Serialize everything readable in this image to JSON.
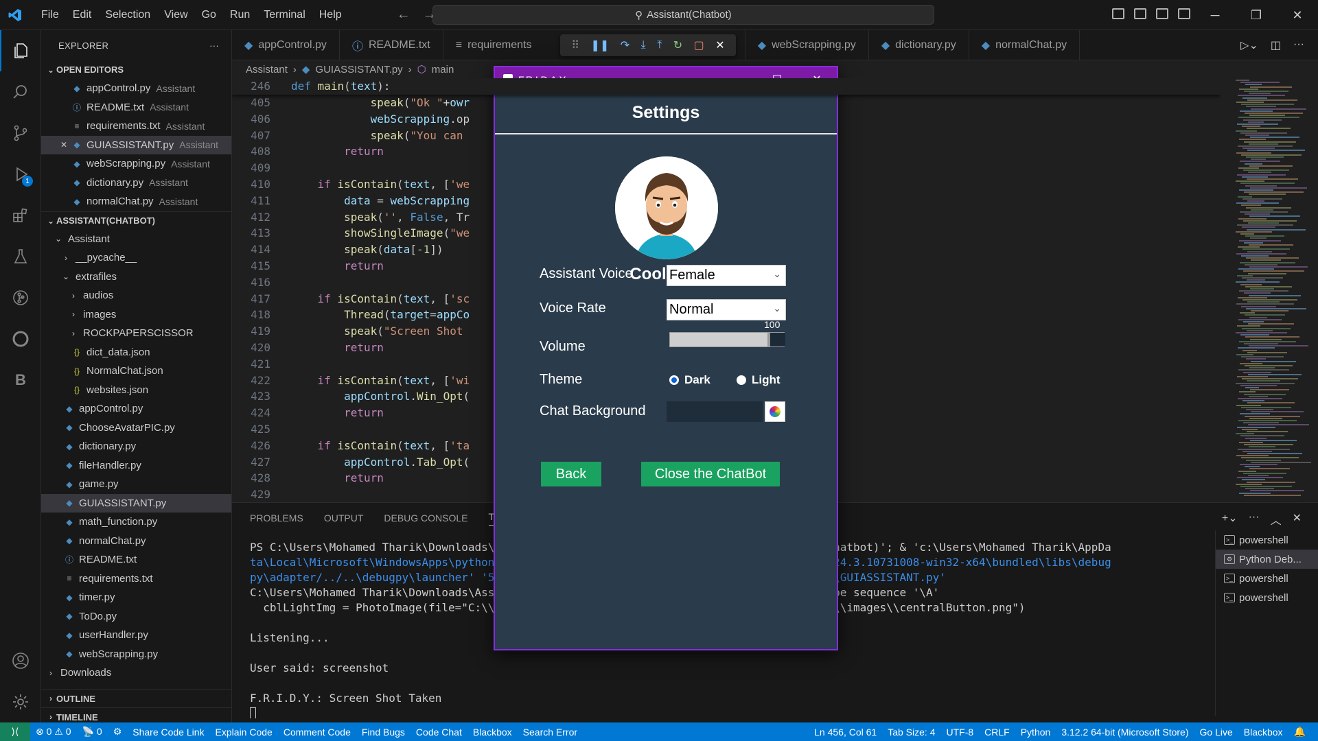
{
  "titlebar": {
    "menu": [
      "File",
      "Edit",
      "Selection",
      "View",
      "Go",
      "Run",
      "Terminal",
      "Help"
    ],
    "search_text": "Assistant(Chatbot)"
  },
  "activity": {
    "debug_badge": "1"
  },
  "sidebar": {
    "header": "EXPLORER",
    "open_editors_title": "OPEN EDITORS",
    "open_editors": [
      {
        "name": "appControl.py",
        "desc": "Assistant",
        "icon": "python-file-icon"
      },
      {
        "name": "README.txt",
        "desc": "Assistant",
        "icon": "info-file-icon"
      },
      {
        "name": "requirements.txt",
        "desc": "Assistant",
        "icon": "text-file-icon"
      },
      {
        "name": "GUIASSISTANT.py",
        "desc": "Assistant",
        "icon": "python-file-icon"
      },
      {
        "name": "webScrapping.py",
        "desc": "Assistant",
        "icon": "python-file-icon"
      },
      {
        "name": "dictionary.py",
        "desc": "Assistant",
        "icon": "python-file-icon"
      },
      {
        "name": "normalChat.py",
        "desc": "Assistant",
        "icon": "python-file-icon"
      }
    ],
    "project_title": "ASSISTANT(CHATBOT)",
    "tree": [
      {
        "name": "Assistant",
        "type": "folder-open",
        "indent": 1
      },
      {
        "name": "__pycache__",
        "type": "folder",
        "indent": 2
      },
      {
        "name": "extrafiles",
        "type": "folder-open",
        "indent": 2
      },
      {
        "name": "audios",
        "type": "folder",
        "indent": 3
      },
      {
        "name": "images",
        "type": "folder",
        "indent": 3
      },
      {
        "name": "ROCKPAPERSCISSOR",
        "type": "folder",
        "indent": 3
      },
      {
        "name": "dict_data.json",
        "type": "json",
        "indent": 2
      },
      {
        "name": "NormalChat.json",
        "type": "json",
        "indent": 2
      },
      {
        "name": "websites.json",
        "type": "json",
        "indent": 2
      },
      {
        "name": "appControl.py",
        "type": "py",
        "indent": 1
      },
      {
        "name": "ChooseAvatarPIC.py",
        "type": "py",
        "indent": 1
      },
      {
        "name": "dictionary.py",
        "type": "py",
        "indent": 1
      },
      {
        "name": "fileHandler.py",
        "type": "py",
        "indent": 1
      },
      {
        "name": "game.py",
        "type": "py",
        "indent": 1
      },
      {
        "name": "GUIASSISTANT.py",
        "type": "py",
        "indent": 1,
        "selected": true
      },
      {
        "name": "math_function.py",
        "type": "py",
        "indent": 1
      },
      {
        "name": "normalChat.py",
        "type": "py",
        "indent": 1
      },
      {
        "name": "README.txt",
        "type": "info",
        "indent": 1
      },
      {
        "name": "requirements.txt",
        "type": "txt",
        "indent": 1
      },
      {
        "name": "timer.py",
        "type": "py",
        "indent": 1
      },
      {
        "name": "ToDo.py",
        "type": "py",
        "indent": 1
      },
      {
        "name": "userHandler.py",
        "type": "py",
        "indent": 1
      },
      {
        "name": "webScrapping.py",
        "type": "py",
        "indent": 1
      },
      {
        "name": "Downloads",
        "type": "folder",
        "indent": 0
      }
    ],
    "outline_title": "OUTLINE",
    "timeline_title": "TIMELINE"
  },
  "tabs": [
    {
      "label": "appControl.py",
      "icon": "python-file-icon"
    },
    {
      "label": "README.txt",
      "icon": "info-file-icon"
    },
    {
      "label": "requirements",
      "icon": "text-file-icon"
    },
    {
      "label": "webScrapping.py",
      "icon": "python-file-icon"
    },
    {
      "label": "dictionary.py",
      "icon": "python-file-icon"
    },
    {
      "label": "normalChat.py",
      "icon": "python-file-icon"
    }
  ],
  "breadcrumb": [
    "Assistant",
    "GUIASSISTANT.py",
    "main"
  ],
  "code": {
    "sticky": {
      "num": "246",
      "text": "def main(text):"
    },
    "lines": [
      {
        "num": "405",
        "text": "            speak(\"Ok \"+owr"
      },
      {
        "num": "406",
        "text": "            webScrapping.op"
      },
      {
        "num": "407",
        "text": "            speak(\"You can "
      },
      {
        "num": "408",
        "text": "        return"
      },
      {
        "num": "409",
        "text": ""
      },
      {
        "num": "410",
        "text": "    if isContain(text, ['we"
      },
      {
        "num": "411",
        "text": "        data = webScrapping"
      },
      {
        "num": "412",
        "text": "        speak('', False, Tr"
      },
      {
        "num": "413",
        "text": "        showSingleImage(\"we"
      },
      {
        "num": "414",
        "text": "        speak(data[-1])"
      },
      {
        "num": "415",
        "text": "        return"
      },
      {
        "num": "416",
        "text": ""
      },
      {
        "num": "417",
        "text": "    if isContain(text, ['sc"
      },
      {
        "num": "418",
        "text": "        Thread(target=appCo"
      },
      {
        "num": "419",
        "text": "        speak(\"Screen Shot "
      },
      {
        "num": "420",
        "text": "        return"
      },
      {
        "num": "421",
        "text": ""
      },
      {
        "num": "422",
        "text": "    if isContain(text, ['wi"
      },
      {
        "num": "423",
        "text": "        appControl.Win_Opt("
      },
      {
        "num": "424",
        "text": "        return"
      },
      {
        "num": "425",
        "text": ""
      },
      {
        "num": "426",
        "text": "    if isContain(text, ['ta"
      },
      {
        "num": "427",
        "text": "        appControl.Tab_Opt("
      },
      {
        "num": "428",
        "text": "        return"
      },
      {
        "num": "429",
        "text": ""
      }
    ]
  },
  "panel": {
    "tabs": [
      "PROBLEMS",
      "OUTPUT",
      "DEBUG CONSOLE",
      "TERMI"
    ],
    "terminal_lines": [
      {
        "left": "PS C:\\Users\\Mohamed Tharik\\Downloads\\Ass",
        "right": "oads\\Assistant(Chatbot)'; & 'c:\\Users\\Mohamed Tharik\\AppDa"
      },
      {
        "left": "ta\\Local\\Microsoft\\WindowsApps\\python3.",
        "right": "ython.debugpy-2024.3.10731008-win32-x64\\bundled\\libs\\debug"
      },
      {
        "left": "py\\adapter/../..\\debugpy\\launcher' '573",
        "right": "atbot)\\Assistant\\GUIASSISTANT.py'"
      },
      {
        "left": "C:\\Users\\Mohamed Tharik\\Downloads\\Assis",
        "right": "ng: invalid escape sequence '\\A'"
      },
      {
        "left": "  cblLightImg = PhotoImage(file=\"C:\\\\Use",
        "right": "tant\\\\extrafiles\\\\images\\\\centralButton.png\")"
      },
      {
        "left": "",
        "right": ""
      },
      {
        "left": "Listening...",
        "right": ""
      },
      {
        "left": "",
        "right": ""
      },
      {
        "left": "User said: screenshot",
        "right": ""
      },
      {
        "left": "",
        "right": ""
      },
      {
        "left": "F.R.I.D.Y.: Screen Shot Taken",
        "right": ""
      }
    ],
    "terminals": [
      "powershell",
      "Python Deb...",
      "powershell",
      "powershell"
    ]
  },
  "statusbar": {
    "errors": "0",
    "warnings": "0",
    "ports": "0",
    "left_items": [
      "Share Code Link",
      "Explain Code",
      "Comment Code",
      "Find Bugs",
      "Code Chat",
      "Blackbox",
      "Search Error"
    ],
    "right_items": [
      "Ln 456, Col 61",
      "Tab Size: 4",
      "UTF-8",
      "CRLF",
      "Python",
      "3.12.2 64-bit (Microsoft Store)",
      "Go Live",
      "Blackbox"
    ]
  },
  "friday": {
    "window_title": "F.R.I.D.A.Y",
    "heading": "Settings",
    "user_name": "Cool Boy",
    "assistant_voice_label": "Assistant Voice",
    "assistant_voice_value": "Female",
    "voice_rate_label": "Voice Rate",
    "voice_rate_value": "Normal",
    "volume_label": "Volume",
    "volume_value": "100",
    "volume_fraction": 1.0,
    "theme_label": "Theme",
    "theme_dark": "Dark",
    "theme_light": "Light",
    "theme_selected": "Dark",
    "chat_bg_label": "Chat Background",
    "back_button": "Back",
    "close_button": "Close the ChatBot"
  },
  "colors": {
    "accent": "#0078d4",
    "friday_titlebar": "#7d1ba8",
    "friday_bg": "#2a3b4b",
    "button_green": "#1aa260"
  }
}
